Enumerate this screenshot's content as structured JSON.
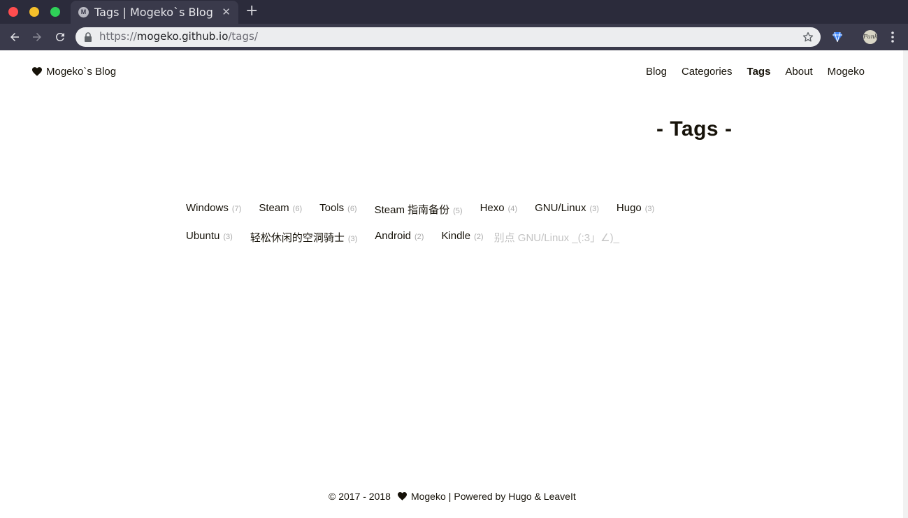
{
  "browser": {
    "tab_title": "Tags | Mogeko`s Blog",
    "tab_favicon_letter": "M",
    "tab_close": "✕",
    "new_tab": "+",
    "url_scheme": "https://",
    "url_host": "mogeko.github.io",
    "url_path": "/tags/",
    "avatar_text": "Funk"
  },
  "site": {
    "brand": "Mogeko`s Blog",
    "nav": [
      {
        "label": "Blog",
        "active": false
      },
      {
        "label": "Categories",
        "active": false
      },
      {
        "label": "Tags",
        "active": true
      },
      {
        "label": "About",
        "active": false
      },
      {
        "label": "Mogeko",
        "active": false
      }
    ]
  },
  "main": {
    "title": "- Tags -",
    "tags": [
      {
        "name": "Windows",
        "count": "(7)"
      },
      {
        "name": "Steam",
        "count": "(6)"
      },
      {
        "name": "Tools",
        "count": "(6)"
      },
      {
        "name": "Steam 指南备份",
        "count": "(5)"
      },
      {
        "name": "Hexo",
        "count": "(4)"
      },
      {
        "name": "GNU/Linux",
        "count": "(3)"
      },
      {
        "name": "Hugo",
        "count": "(3)"
      },
      {
        "name": "Ubuntu",
        "count": "(3)"
      },
      {
        "name": "轻松休闲的空洞骑士",
        "count": "(3)"
      },
      {
        "name": "Android",
        "count": "(2)"
      },
      {
        "name": "Kindle",
        "count": "(2)"
      },
      {
        "name": "别点 GNU/Linux _(:3」∠)_",
        "count": ""
      }
    ]
  },
  "footer": {
    "copyright": "© 2017 - 2018",
    "author": "Mogeko",
    "separator": "|",
    "powered": "Powered by Hugo & LeaveIt"
  },
  "colors": {
    "chrome_dark": "#2b2b3b",
    "chrome_toolbar": "#3a3a4b",
    "text": "#161209",
    "muted": "#a9a9a9"
  }
}
